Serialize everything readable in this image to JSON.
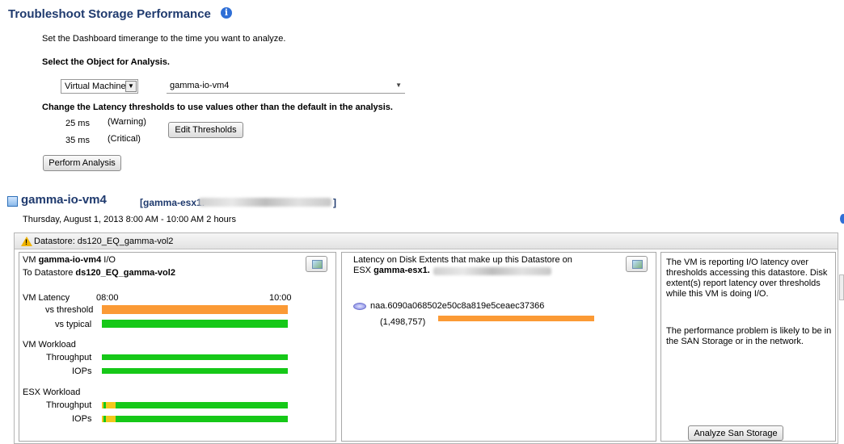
{
  "header": {
    "title": "Troubleshoot Storage Performance",
    "instruction": "Set the Dashboard timerange to the time you want to analyze.",
    "select_label": "Select the Object for Analysis.",
    "object_type": "Virtual Machine",
    "object_name": "gamma-io-vm4",
    "threshold_label": "Change the Latency thresholds to use values other than the default in the analysis.",
    "warning_value": "25 ms",
    "warning_label": "(Warning)",
    "critical_value": "35 ms",
    "critical_label": "(Critical)",
    "edit_thresholds_label": "Edit Thresholds",
    "perform_analysis_label": "Perform Analysis"
  },
  "result": {
    "vm_name": "gamma-io-vm4",
    "host_prefix": "[gamma-esx1.",
    "host_suffix": "]",
    "timerange": "Thursday, August 1, 2013 8:00 AM - 10:00 AM  2 hours",
    "datastore_header": "Datastore: ds120_EQ_gamma-vol2"
  },
  "left_panel": {
    "title_prefix": "VM ",
    "title_vm": "gamma-io-vm4",
    "title_suffix": " I/O",
    "to_prefix": "To Datastore ",
    "to_datastore": "ds120_EQ_gamma-vol2",
    "vm_latency_label": "VM Latency",
    "time_start": "08:00",
    "time_end": "10:00",
    "vs_threshold": "vs threshold",
    "vs_typical": "vs typical",
    "vm_workload": "VM Workload",
    "throughput": "Throughput",
    "iops": "IOPs",
    "esx_workload": "ESX Workload",
    "esx_throughput": "Throughput",
    "esx_iops": "IOPs"
  },
  "middle_panel": {
    "line1": "Latency on Disk Extents that make up this Datastore on",
    "line2_prefix": "ESX ",
    "line2_host": "gamma-esx1.",
    "extent_name": "naa.6090a068502e50c8a819e5ceaec37366",
    "extent_value": "(1,498,757)"
  },
  "right_panel": {
    "text1": "The VM is reporting I/O latency over thresholds accessing this datastore. Disk extent(s) report latency over thresholds while this VM is doing I/O.",
    "text2": "The performance problem is likely to be in the SAN Storage or in the network.",
    "analyze_button": "Analyze San Storage"
  },
  "colors": {
    "critical": "#fb9a35",
    "normal": "#16c818",
    "warning": "#f2c81a",
    "title_blue": "#1f3a6e"
  }
}
